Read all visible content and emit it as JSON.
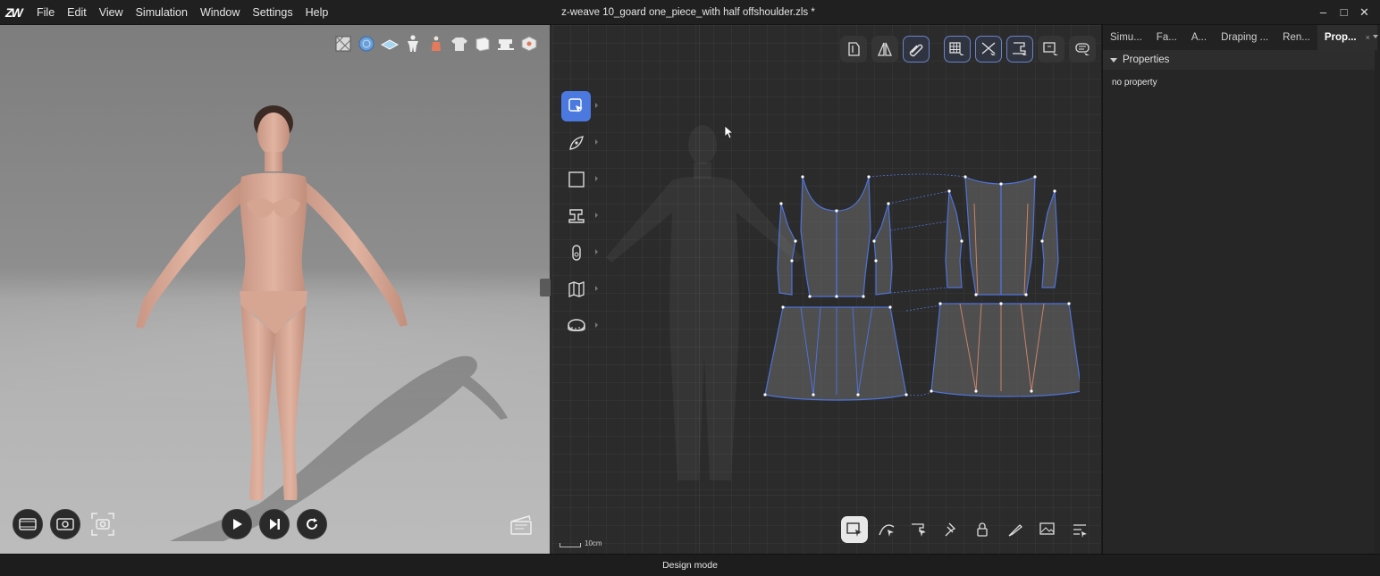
{
  "app": {
    "logo_text": "ZW",
    "menu": [
      "File",
      "Edit",
      "View",
      "Simulation",
      "Window",
      "Settings",
      "Help"
    ],
    "document_title": "z-weave 10_goard one_piece_with half offshoulder.zls *",
    "window_controls": {
      "minimize": "–",
      "maximize": "□",
      "close": "✕"
    }
  },
  "viewport3d": {
    "toolbar_icons": [
      "texture-icon",
      "fabric-ball-icon",
      "fabric-layer-icon",
      "avatar-icon",
      "avatar-pose-icon",
      "garment-icon",
      "cube-icon",
      "sewing-machine-icon",
      "box-3d-icon"
    ],
    "record_tools": [
      "record-video-icon",
      "screen-capture-icon",
      "snapshot-icon"
    ],
    "playback": [
      "play-icon",
      "step-forward-icon",
      "reset-icon"
    ],
    "clapper_icon": "clapperboard-icon"
  },
  "pattern2d": {
    "left_tools": [
      "select-transform-icon",
      "pen-tool-icon",
      "rectangle-tool-icon",
      "sewing-tool-icon",
      "zipper-tool-icon",
      "fold-tool-icon",
      "measure-tape-icon"
    ],
    "top_tools": [
      "pattern-piece-icon",
      "mirror-pattern-icon",
      "link-icon",
      "grid-view-icon",
      "cut-view-icon",
      "sew-view-icon",
      "display-icon",
      "fabric-print-icon"
    ],
    "bottom_tools": [
      "select-box-icon",
      "edit-curve-icon",
      "sewing-edit-icon",
      "pin-icon",
      "lock-icon",
      "knife-icon",
      "image-icon",
      "settings-list-icon"
    ],
    "scale_label": "10cm"
  },
  "right_panel": {
    "tabs": [
      "Simu...",
      "Fa...",
      "A...",
      "Draping ...",
      "Ren...",
      "Prop..."
    ],
    "active_tab_close": "×",
    "section_title": "Properties",
    "empty_message": "no property"
  },
  "status": {
    "mode": "Design mode"
  },
  "colors": {
    "active_tool": "#4b79e0",
    "pattern_outline": "#4f73d9",
    "pattern_fill": "#6c6c6c",
    "seam_orange": "#c9836a",
    "background": "#2b2b2b"
  }
}
